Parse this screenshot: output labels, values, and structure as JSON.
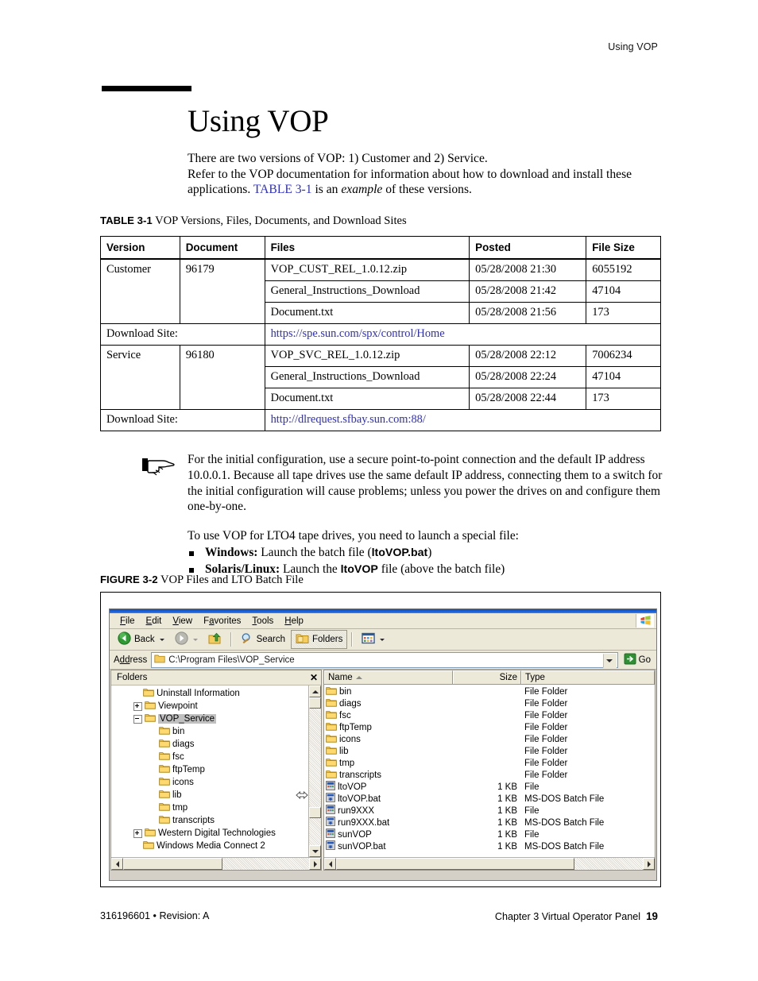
{
  "running_head": "Using VOP",
  "title": "Using VOP",
  "intro": {
    "line1": "There are two versions of VOP: 1) Customer and 2) Service.",
    "line2_a": "Refer to the VOP documentation for information about how to download and install these applications. ",
    "link": "TABLE 3-1",
    "line2_b": " is an ",
    "italic": "example",
    "line2_c": " of these versions."
  },
  "table_caption": {
    "label": "TABLE 3-1",
    "text": "VOP Versions, Files, Documents, and Download Sites"
  },
  "table": {
    "headers": [
      "Version",
      "Document",
      "Files",
      "Posted",
      "File Size"
    ],
    "groups": [
      {
        "version": "Customer",
        "document": "96179",
        "rows": [
          {
            "file": "VOP_CUST_REL_1.0.12.zip",
            "posted": "05/28/2008 21:30",
            "size": "6055192",
            "indent": false
          },
          {
            "file": "General_Instructions_Download",
            "posted": "05/28/2008 21:42",
            "size": "47104",
            "indent": false
          },
          {
            "file": "Document.txt",
            "posted": "05/28/2008 21:56",
            "size": "173",
            "indent": true
          }
        ],
        "download_label": "Download Site:",
        "download_url": "https://spe.sun.com/spx/control/Home"
      },
      {
        "version": "Service",
        "document": "96180",
        "rows": [
          {
            "file": "VOP_SVC_REL_1.0.12.zip",
            "posted": "05/28/2008 22:12",
            "size": "7006234",
            "indent": false
          },
          {
            "file": "General_Instructions_Download",
            "posted": "05/28/2008 22:24",
            "size": "47104",
            "indent": false
          },
          {
            "file": "Document.txt",
            "posted": "05/28/2008 22:44",
            "size": "173",
            "indent": true
          }
        ],
        "download_label": "Download Site:",
        "download_url": "http://dlrequest.sfbay.sun.com:88/"
      }
    ]
  },
  "note": {
    "paragraph1": "For the initial configuration, use a secure point-to-point connection and the default IP address 10.0.0.1. Because all tape drives use the same default IP address, connecting them to a switch for the initial configuration will cause problems; unless you power the drives on and configure them one-by-one.",
    "paragraph2": "To use VOP for LTO4 tape drives, you need to launch a special file:",
    "bullets": [
      {
        "lead": "Windows:",
        "mid": " Launch the batch file (",
        "code": "ltoVOP.bat",
        "tail": ")"
      },
      {
        "lead": "Solaris/Linux:",
        "mid": " Launch the ",
        "code": "ltoVOP",
        "tail": " file (above the batch file)"
      }
    ]
  },
  "figure_caption": {
    "label": "FIGURE 3-2",
    "text": "VOP Files and LTO Batch File"
  },
  "explorer": {
    "menu": [
      "File",
      "Edit",
      "View",
      "Favorites",
      "Tools",
      "Help"
    ],
    "toolbar": {
      "back": "Back",
      "search": "Search",
      "folders": "Folders",
      "views": ""
    },
    "address": {
      "label": "Address",
      "value": "C:\\Program Files\\VOP_Service",
      "go": "Go"
    },
    "tree": {
      "header": "Folders",
      "close": "✕",
      "items": [
        {
          "label": "Uninstall Information",
          "indent": 1,
          "toggle": "none",
          "selected": false
        },
        {
          "label": "Viewpoint",
          "indent": 1,
          "toggle": "plus",
          "selected": false
        },
        {
          "label": "VOP_Service",
          "indent": 1,
          "toggle": "minus",
          "selected": true
        },
        {
          "label": "bin",
          "indent": 2,
          "toggle": "none",
          "selected": false
        },
        {
          "label": "diags",
          "indent": 2,
          "toggle": "none",
          "selected": false
        },
        {
          "label": "fsc",
          "indent": 2,
          "toggle": "none",
          "selected": false
        },
        {
          "label": "ftpTemp",
          "indent": 2,
          "toggle": "none",
          "selected": false
        },
        {
          "label": "icons",
          "indent": 2,
          "toggle": "none",
          "selected": false
        },
        {
          "label": "lib",
          "indent": 2,
          "toggle": "none",
          "selected": false
        },
        {
          "label": "tmp",
          "indent": 2,
          "toggle": "none",
          "selected": false
        },
        {
          "label": "transcripts",
          "indent": 2,
          "toggle": "none",
          "selected": false
        },
        {
          "label": "Western Digital Technologies",
          "indent": 1,
          "toggle": "plus",
          "selected": false
        },
        {
          "label": "Windows Media Connect 2",
          "indent": 1,
          "toggle": "none",
          "selected": false
        }
      ]
    },
    "list": {
      "columns": [
        "Name",
        "Size",
        "Type"
      ],
      "rows": [
        {
          "name": "bin",
          "size": "",
          "type": "File Folder",
          "icon": "folder-icon"
        },
        {
          "name": "diags",
          "size": "",
          "type": "File Folder",
          "icon": "folder-icon"
        },
        {
          "name": "fsc",
          "size": "",
          "type": "File Folder",
          "icon": "folder-icon"
        },
        {
          "name": "ftpTemp",
          "size": "",
          "type": "File Folder",
          "icon": "folder-icon"
        },
        {
          "name": "icons",
          "size": "",
          "type": "File Folder",
          "icon": "folder-icon"
        },
        {
          "name": "lib",
          "size": "",
          "type": "File Folder",
          "icon": "folder-icon"
        },
        {
          "name": "tmp",
          "size": "",
          "type": "File Folder",
          "icon": "folder-icon"
        },
        {
          "name": "transcripts",
          "size": "",
          "type": "File Folder",
          "icon": "folder-icon"
        },
        {
          "name": "ltoVOP",
          "size": "1 KB",
          "type": "File",
          "icon": "generic-file-icon"
        },
        {
          "name": "ltoVOP.bat",
          "size": "1 KB",
          "type": "MS-DOS Batch File",
          "icon": "batch-file-icon"
        },
        {
          "name": "run9XXX",
          "size": "1 KB",
          "type": "File",
          "icon": "generic-file-icon"
        },
        {
          "name": "run9XXX.bat",
          "size": "1 KB",
          "type": "MS-DOS Batch File",
          "icon": "batch-file-icon"
        },
        {
          "name": "sunVOP",
          "size": "1 KB",
          "type": "File",
          "icon": "generic-file-icon"
        },
        {
          "name": "sunVOP.bat",
          "size": "1 KB",
          "type": "MS-DOS Batch File",
          "icon": "batch-file-icon"
        }
      ]
    }
  },
  "footer": {
    "left": "316196601  •  Revision: A",
    "right": "Chapter 3 Virtual Operator Panel",
    "page": "19"
  },
  "colors": {
    "link": "#2d2dcf",
    "titlebar": "#0a4fc4",
    "chrome": "#ece9d8",
    "folder": "#fbd46a",
    "selection": "#c0c0c0"
  }
}
